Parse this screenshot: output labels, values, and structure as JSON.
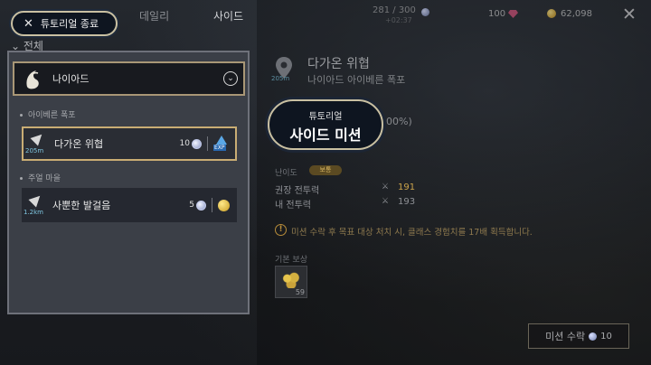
{
  "top": {
    "tabs": [
      "데일리",
      "사이드"
    ],
    "active_tab": "사이드",
    "progress": "281 / 300",
    "progress_sub": "+02:37",
    "gems": "100",
    "gold": "62,098"
  },
  "tutorial_button": {
    "label": "튜토리얼 종료"
  },
  "filter_label": "전체",
  "region": {
    "name": "나이아드"
  },
  "groups": [
    {
      "label": "아이베른 폭포",
      "missions": [
        {
          "title": "다가온 위협",
          "distance": "205m",
          "count": "10",
          "reward_icon": "exp-icon"
        }
      ]
    },
    {
      "label": "주얼 마을",
      "missions": [
        {
          "title": "사뿐한 발걸음",
          "distance": "1.2km",
          "count": "5",
          "reward_icon": "gold-coin-icon"
        }
      ]
    }
  ],
  "detail": {
    "title": "다가온 위협",
    "subtitle": "나이아드 아이베른 폭포",
    "distance": "205m",
    "percent": "100%)",
    "tutorial_small": "튜토리얼",
    "tutorial_big": "사이드 미션",
    "difficulty_label": "난이도",
    "difficulty_value": "보통",
    "recommended_label": "권장 전투력",
    "recommended_value": "191",
    "my_label": "내 전투력",
    "my_value": "193",
    "notice": "미션 수락 후 목표 대상 처치 시, 클래스 경험치를 17배 획득합니다.",
    "reward_label": "기본 보상",
    "reward_count": "59",
    "accept_label": "미션 수락",
    "accept_cost": "10"
  },
  "colors": {
    "accent_border": "#c9c0a2",
    "recommended": "#c9a24a",
    "my_power": "#8e9095"
  }
}
